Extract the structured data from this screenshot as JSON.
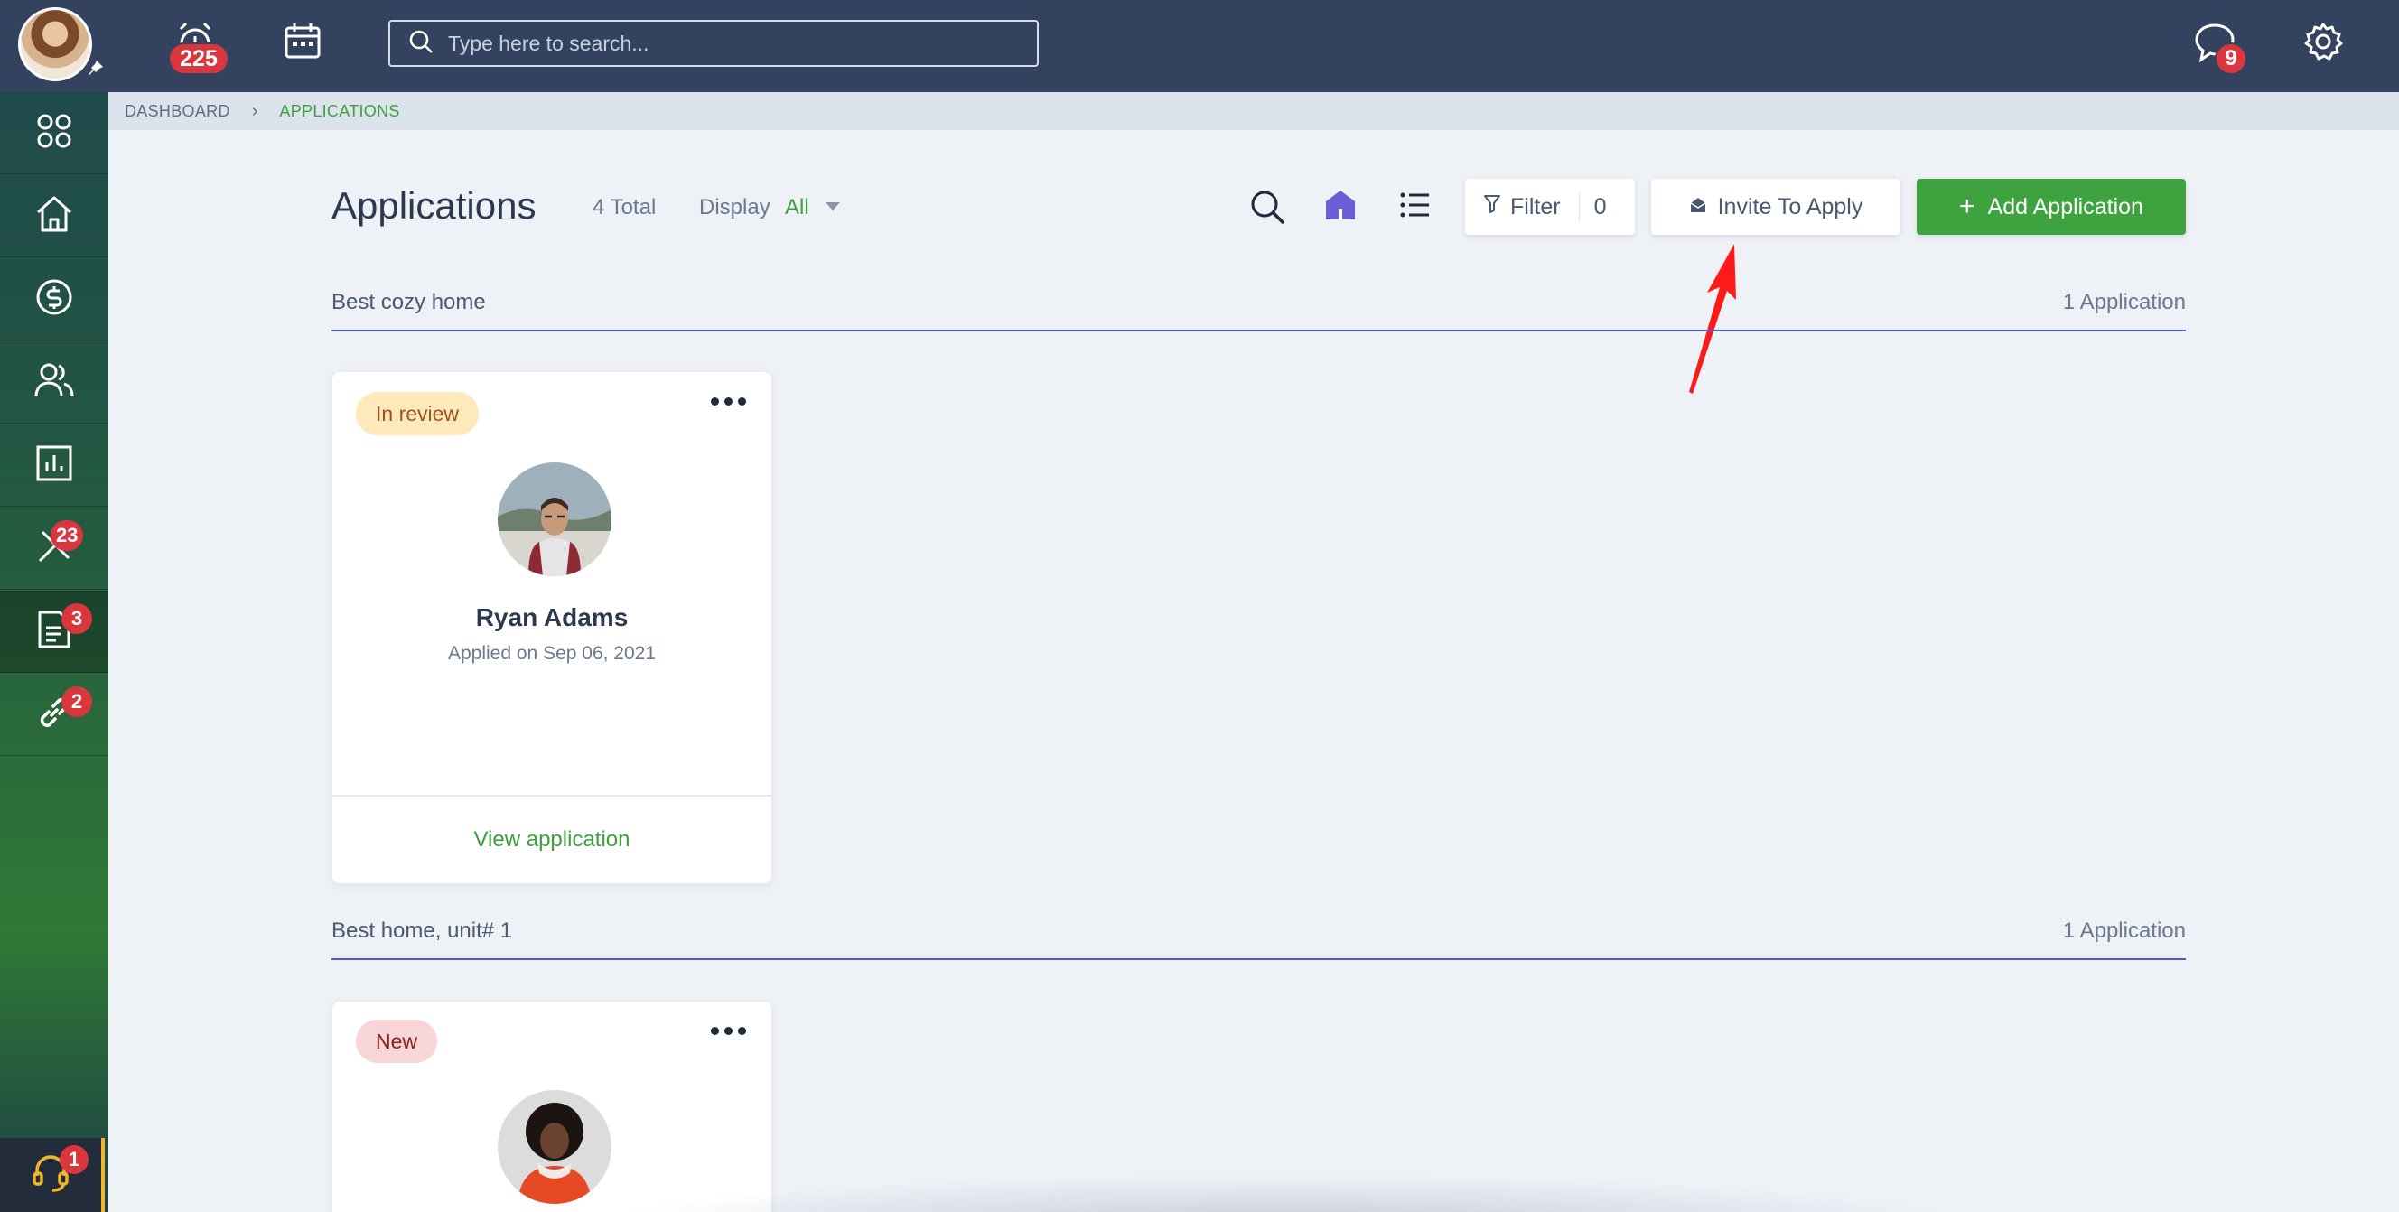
{
  "topbar": {
    "alarm_count": "225",
    "search_placeholder": "Type here to search...",
    "chat_count": "9"
  },
  "sidebar": {
    "maintenance_count": "23",
    "applications_count": "3",
    "links_count": "2",
    "help_count": "1"
  },
  "breadcrumb": {
    "items": [
      "DASHBOARD",
      "APPLICATIONS"
    ]
  },
  "header": {
    "title": "Applications",
    "total": "4 Total",
    "display_label": "Display",
    "display_value": "All",
    "filter_label": "Filter",
    "filter_count": "0",
    "invite_label": "Invite To Apply",
    "add_label": "Add Application"
  },
  "groups": [
    {
      "title": "Best cozy home",
      "count": "1 Application",
      "card": {
        "status": "In review",
        "name": "Ryan Adams",
        "applied": "Applied on Sep 06, 2021",
        "link": "View application"
      }
    },
    {
      "title": "Best home, unit# 1",
      "count": "1 Application",
      "card": {
        "status": "New"
      }
    }
  ],
  "colors": {
    "topbar": "#33435f",
    "accent_green": "#3ea33e",
    "badge_red": "#d9363e",
    "group_line": "#4b5bd0",
    "annotation_arrow": "#ff0000"
  }
}
